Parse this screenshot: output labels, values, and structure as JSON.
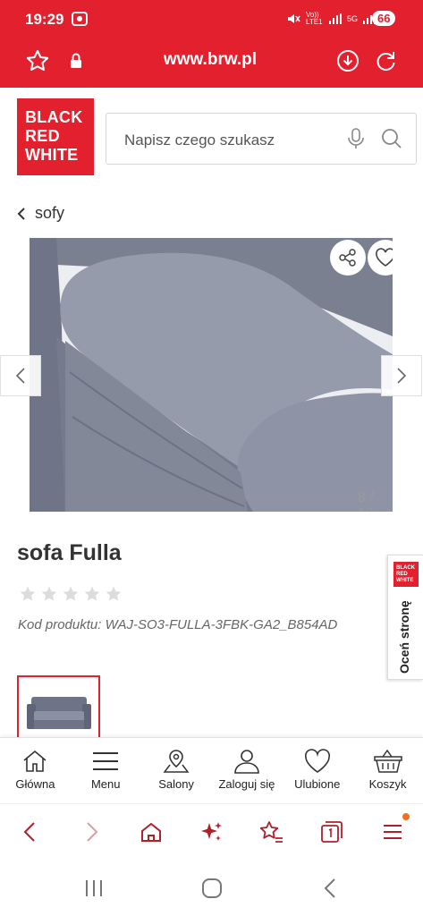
{
  "status_bar": {
    "time": "19:29",
    "signal_text_1": "Vo)) LTE1",
    "signal_text_2": "5G",
    "battery": "66"
  },
  "browser": {
    "url": "www.brw.pl"
  },
  "header": {
    "logo_lines": [
      "BLACK",
      "RED",
      "WHITE"
    ],
    "search_placeholder": "Napisz czego szukasz"
  },
  "breadcrumb": {
    "label": "sofy"
  },
  "gallery": {
    "counter": "8 / 10"
  },
  "product": {
    "title": "sofa Fulla",
    "rating_stars_filled": 0,
    "rating_stars_total": 5,
    "code": "Kod produktu: WAJ-SO3-FULLA-3FBK-GA2_B854AD"
  },
  "rate_tab": {
    "label": "Oceń stronę",
    "logo_lines": [
      "BLACK",
      "RED",
      "WHITE"
    ]
  },
  "site_nav": [
    {
      "label": "Główna",
      "icon": "home-icon"
    },
    {
      "label": "Menu",
      "icon": "hamburger-icon"
    },
    {
      "label": "Salony",
      "icon": "map-pin-icon"
    },
    {
      "label": "Zaloguj się",
      "icon": "user-icon"
    },
    {
      "label": "Ulubione",
      "icon": "heart-icon"
    },
    {
      "label": "Koszyk",
      "icon": "basket-icon"
    }
  ],
  "colors": {
    "brand_red": "#e3202d",
    "browser_icon_red": "#b0202a"
  }
}
